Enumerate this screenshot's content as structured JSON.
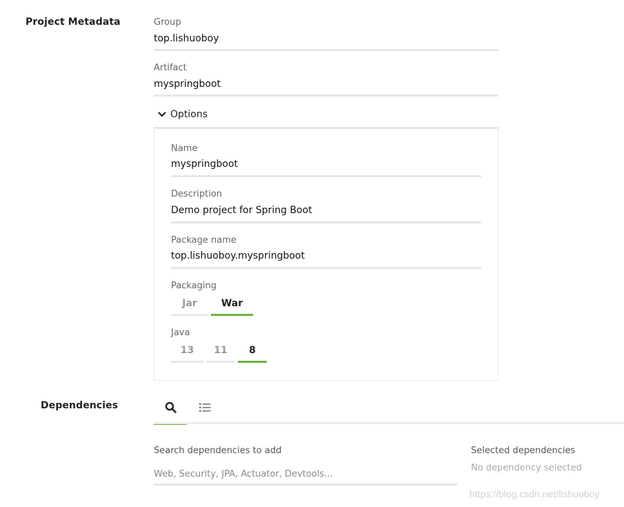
{
  "project_metadata": {
    "title": "Project Metadata",
    "group": {
      "label": "Group",
      "value": "top.lishuoboy"
    },
    "artifact": {
      "label": "Artifact",
      "value": "myspringboot"
    },
    "options_label": "Options",
    "options": {
      "name": {
        "label": "Name",
        "value": "myspringboot"
      },
      "description": {
        "label": "Description",
        "value": "Demo project for Spring Boot"
      },
      "package_name": {
        "label": "Package name",
        "value": "top.lishuoboy.myspringboot"
      },
      "packaging": {
        "label": "Packaging",
        "choices": [
          "Jar",
          "War"
        ],
        "selected": "War"
      },
      "java": {
        "label": "Java",
        "choices": [
          "13",
          "11",
          "8"
        ],
        "selected": "8"
      }
    }
  },
  "dependencies": {
    "title": "Dependencies",
    "tabs": [
      {
        "icon": "search-icon",
        "active": true
      },
      {
        "icon": "list-icon",
        "active": false
      }
    ],
    "search_label": "Search dependencies to add",
    "search_placeholder": "Web, Security, JPA, Actuator, Devtools...",
    "selected_label": "Selected dependencies",
    "selected_empty": "No dependency selected"
  },
  "watermark": "https://blog.csdn.net/lishuoboy",
  "colors": {
    "accent": "#6db33f",
    "divider": "#e6e6e6"
  }
}
